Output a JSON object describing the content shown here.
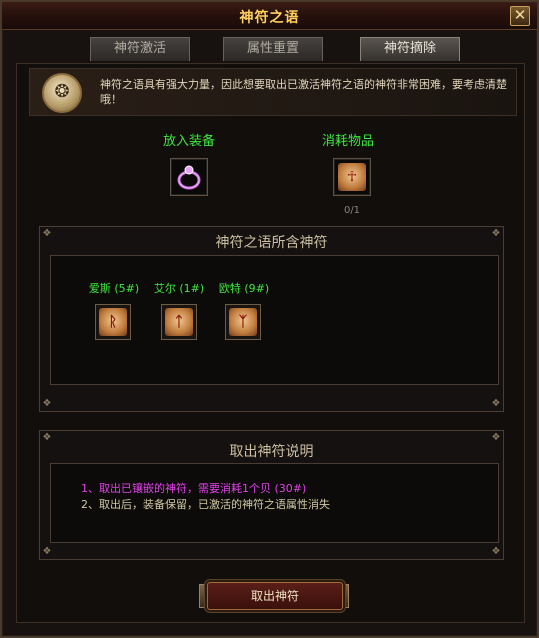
{
  "window": {
    "title": "神符之语",
    "close_label": "✕"
  },
  "tabs": [
    {
      "label": "神符激活",
      "active": false
    },
    {
      "label": "属性重置",
      "active": false
    },
    {
      "label": "神符摘除",
      "active": true
    }
  ],
  "intro": {
    "icon": "rune-scroll-icon",
    "text": "神符之语具有强大力量，因此想要取出已激活神符之语的神符非常困难，要考虑清楚哦！"
  },
  "slots": {
    "equip_label": "放入装备",
    "equip_icon": "ring-icon",
    "consume_label": "消耗物品",
    "consume_icon": "ankh-rune-icon",
    "consume_count": "0/1"
  },
  "runes_section": {
    "title": "神符之语所含神符",
    "runes": [
      {
        "label": "爱斯 (5#)",
        "glyph": "ᚱ",
        "icon": "rune-ais-icon"
      },
      {
        "label": "艾尔 (1#)",
        "glyph": "ᛏ",
        "icon": "rune-air-icon"
      },
      {
        "label": "欧特 (9#)",
        "glyph": "ᛉ",
        "icon": "rune-ot-icon"
      }
    ]
  },
  "description": {
    "title": "取出神符说明",
    "lines": [
      {
        "text": "1、取出已镶嵌的神符，需要消耗1个贝 (30#)",
        "color": "#e040e8"
      },
      {
        "text": "2、取出后，装备保留，已激活的神符之语属性消失",
        "color": "#d0c8a0"
      }
    ]
  },
  "action": {
    "label": "取出神符"
  },
  "colors": {
    "accent_gold": "#ffd060",
    "label_green": "#3ee63e"
  }
}
